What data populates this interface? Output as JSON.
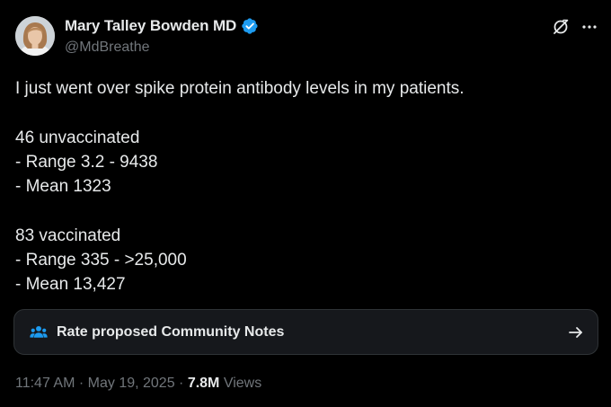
{
  "author": {
    "display_name": "Mary Talley Bowden MD",
    "handle": "@MdBreathe",
    "avatar_icon": "avatar-photo",
    "verified_icon": "verified-badge-icon",
    "verified_color": "#1d9bf0"
  },
  "header_actions": {
    "grok_icon": "grok-icon",
    "more_icon": "more-options-icon"
  },
  "tweet_lines": [
    "I just went over spike protein antibody levels in my patients.",
    "",
    "46 unvaccinated",
    "- Range 3.2 - 9438",
    "- Mean 1323",
    "",
    "83 vaccinated",
    "- Range 335 - >25,000",
    "- Mean 13,427"
  ],
  "community_notes": {
    "label": "Rate proposed Community Notes",
    "icon": "people-icon",
    "icon_color": "#1d9bf0",
    "arrow_icon": "arrow-right-icon"
  },
  "meta": {
    "time": "11:47 AM",
    "separator": " · ",
    "date": "May 19, 2025",
    "views_count": "7.8M",
    "views_label": " Views"
  },
  "colors": {
    "background": "#000000",
    "text_primary": "#e7e9ea",
    "text_secondary": "#71767b",
    "accent": "#1d9bf0",
    "notes_bg": "#16181c",
    "border": "#2f3336"
  }
}
